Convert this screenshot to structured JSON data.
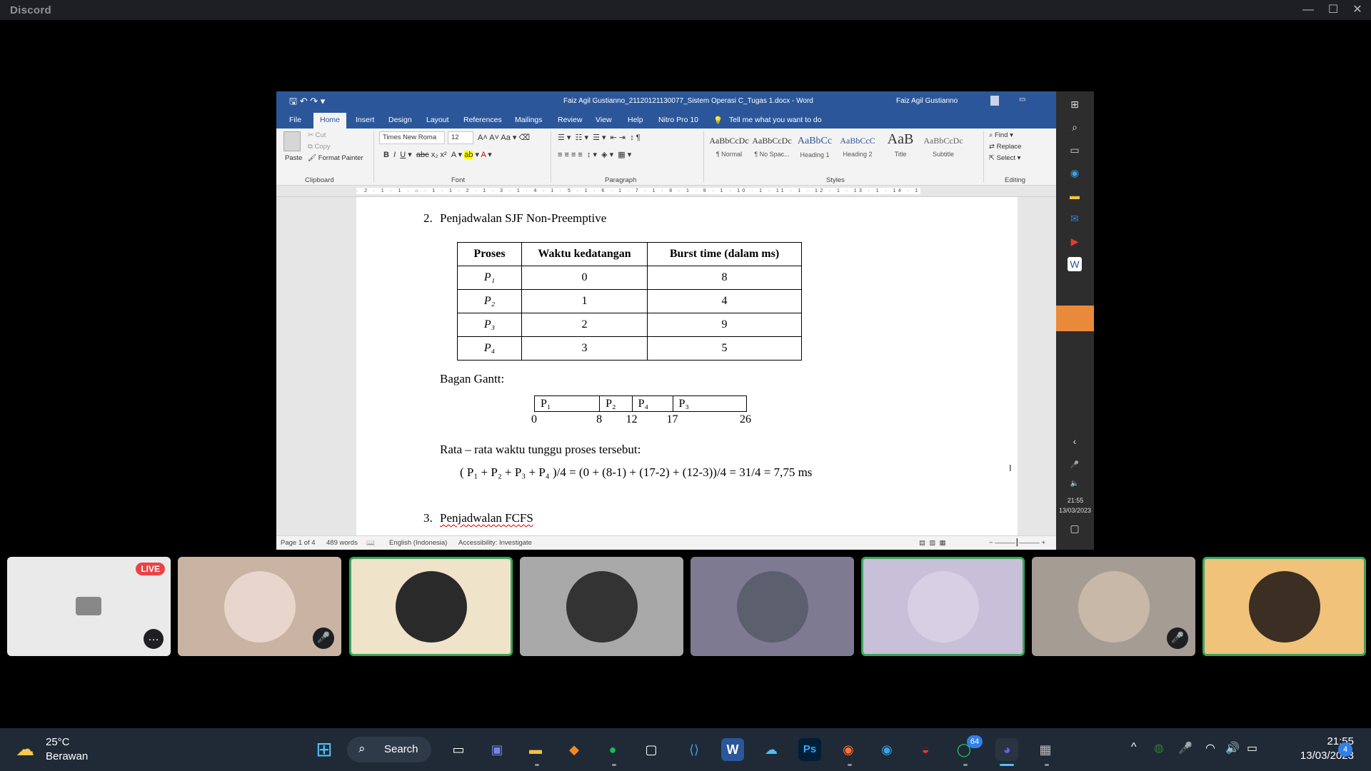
{
  "discord": {
    "title": "Discord",
    "min": "—",
    "max": "☐",
    "close": "✕"
  },
  "word": {
    "doc_title": "Faiz Agil Gustianno_21120121130077_Sistem Operasi C_Tugas 1.docx  -  Word",
    "user": "Faiz Agil Gustianno",
    "tabs": [
      "File",
      "Home",
      "Insert",
      "Design",
      "Layout",
      "References",
      "Mailings",
      "Review",
      "View",
      "Help",
      "Nitro Pro 10"
    ],
    "tell_me": "Tell me what you want to do",
    "clipboard": {
      "paste": "Paste",
      "cut": "Cut",
      "copy": "Copy",
      "format_painter": "Format Painter",
      "label": "Clipboard"
    },
    "font": {
      "name": "Times New Roma",
      "size": "12",
      "label": "Font"
    },
    "paragraph_label": "Paragraph",
    "styles": [
      {
        "sample": "AaBbCcDc",
        "label": "¶ Normal"
      },
      {
        "sample": "AaBbCcDc",
        "label": "¶ No Spac..."
      },
      {
        "sample": "AaBbCc",
        "label": "Heading 1"
      },
      {
        "sample": "AaBbCcC",
        "label": "Heading 2"
      },
      {
        "sample": "AaB",
        "label": "Title"
      },
      {
        "sample": "AaBbCcDc",
        "label": "Subtitle"
      }
    ],
    "styles_label": "Styles",
    "editing": {
      "find": "Find",
      "replace": "Replace",
      "select": "Select",
      "label": "Editing"
    },
    "ruler_text": "· 2 · 1 · 1 · ⌂ · 1 · 1 · 2 · 1 · 3 · 1 · 4 · 1 · 5 · 1 · 6 · 1 · 7 · 1 · 8 · 1 · 9 · 1 · 10 · 1 · 11 · 1 · 12 · 1 · 13 · 1 · 14 · 1 · 15 · 1 · 16 · 1 · 17 · 1 · 18",
    "status": {
      "page": "Page 1 of 4",
      "words": "489 words",
      "language": "English (Indonesia)",
      "accessibility": "Accessibility: Investigate"
    }
  },
  "doc": {
    "section2_num": "2.",
    "section2_title": "Penjadwalan SJF Non-Preemptive",
    "table": {
      "headers": [
        "Proses",
        "Waktu kedatangan",
        "Burst time (dalam ms)"
      ],
      "rows": [
        [
          "P₁",
          "0",
          "8"
        ],
        [
          "P₂",
          "1",
          "4"
        ],
        [
          "P₃",
          "2",
          "9"
        ],
        [
          "P₄",
          "3",
          "5"
        ]
      ]
    },
    "gantt_label": "Bagan Gantt:",
    "gantt_blocks": [
      {
        "label": "P₁",
        "start": 0,
        "end": 8
      },
      {
        "label": "P₂",
        "start": 8,
        "end": 12
      },
      {
        "label": "P₄",
        "start": 12,
        "end": 17
      },
      {
        "label": "P₃",
        "start": 17,
        "end": 26
      }
    ],
    "gantt_ticks": [
      "0",
      "8",
      "12",
      "17",
      "26"
    ],
    "avg_label": "Rata – rata waktu tunggu proses tersebut:",
    "avg_formula": "( P₁ + P₂ + P₃ + P₄ )/4 = (0 + (8-1) + (17-2) + (12-3))/4 =  31/4 = 7,75 ms",
    "section3_num": "3.",
    "section3_title": "Penjadwalan FCFS"
  },
  "screen_sidebar": {
    "time": "21:55",
    "date": "13/03/2023"
  },
  "tiles": [
    {
      "name": "stream-preview",
      "badge": "LIVE",
      "bg": "#3a3d44"
    },
    {
      "name": "participant-1",
      "bg": "#c9b4a4",
      "avatar": "#e8d6cc",
      "muted": true,
      "speaking": false
    },
    {
      "name": "participant-2",
      "bg": "#efe3c9",
      "avatar": "#2a2a2a",
      "muted": false,
      "speaking": true
    },
    {
      "name": "participant-3",
      "bg": "#a9a9a9",
      "avatar": "#333333",
      "muted": false,
      "speaking": false
    },
    {
      "name": "participant-4",
      "bg": "#7e7a92",
      "avatar": "#5c5f6e",
      "muted": false,
      "speaking": false
    },
    {
      "name": "participant-5",
      "bg": "#c7c0d8",
      "avatar": "#d9cfe4",
      "muted": false,
      "speaking": true
    },
    {
      "name": "participant-6",
      "bg": "#a59c94",
      "avatar": "#c7b8a8",
      "muted": true,
      "speaking": false
    },
    {
      "name": "participant-7",
      "bg": "#f0c27a",
      "avatar": "#3b2e22",
      "muted": false,
      "speaking": true
    }
  ],
  "taskbar": {
    "weather_temp": "25°C",
    "weather_desc": "Berawan",
    "search": "Search",
    "time": "21:55",
    "date": "13/03/2023",
    "notif_count": "4",
    "whatsapp_badge": "64"
  }
}
